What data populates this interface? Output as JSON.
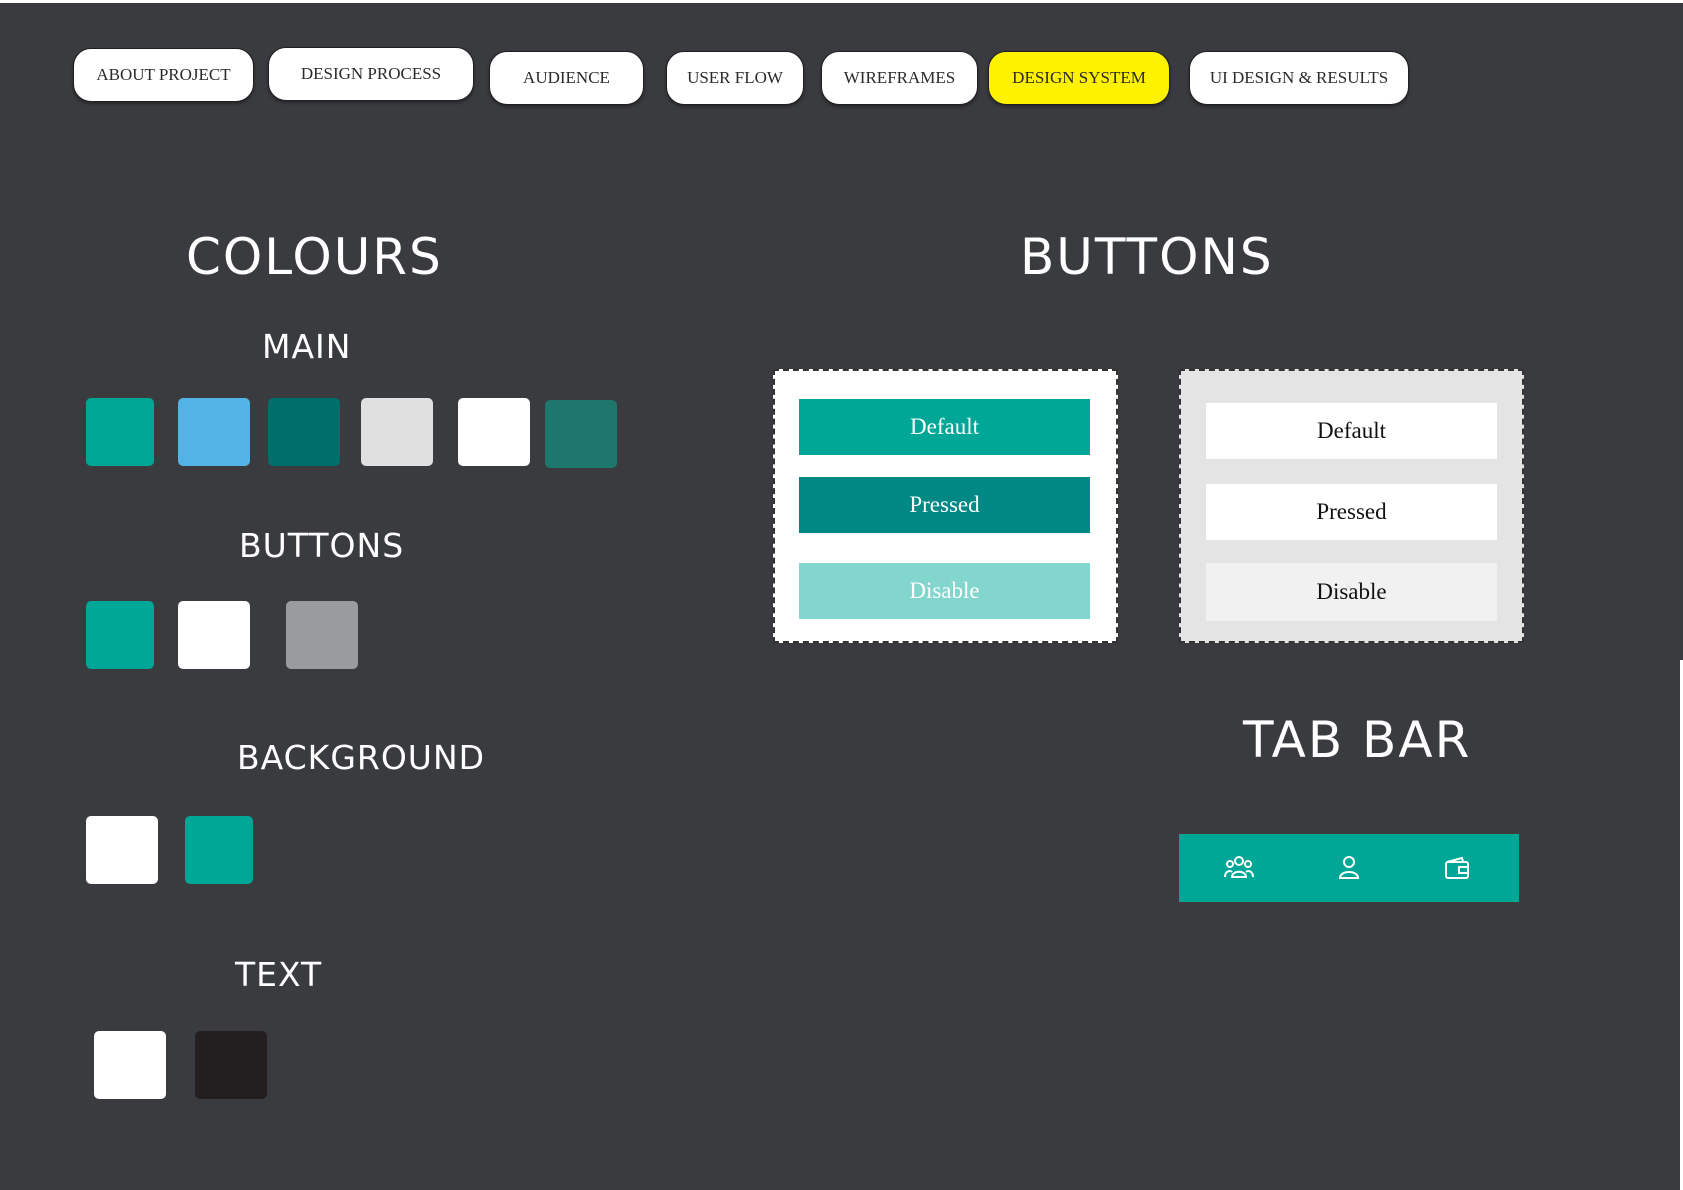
{
  "nav": {
    "items": [
      {
        "label": "ABOUT PROJECT"
      },
      {
        "label": "DESIGN PROCESS"
      },
      {
        "label": "AUDIENCE"
      },
      {
        "label": "USER FLOW"
      },
      {
        "label": "WIREFRAMES"
      },
      {
        "label": "DESIGN SYSTEM",
        "active": true
      },
      {
        "label": "UI DESIGN & RESULTS"
      }
    ]
  },
  "colours": {
    "title": "COLOURS",
    "main": {
      "label": "MAIN",
      "swatches": [
        "#00a696",
        "#52b4e6",
        "#006e69",
        "#dfe0df",
        "#ffffff",
        "#1e776d"
      ]
    },
    "buttons": {
      "label": "BUTTONS",
      "swatches": [
        "#00a696",
        "#ffffff",
        "#9a9b9e"
      ]
    },
    "background": {
      "label": "BACKGROUND",
      "swatches": [
        "#ffffff",
        "#00a696"
      ]
    },
    "text": {
      "label": "TEXT",
      "swatches": [
        "#ffffff",
        "#231f20"
      ]
    }
  },
  "buttons_section": {
    "title": "BUTTONS",
    "primary": {
      "default_label": "Default",
      "pressed_label": "Pressed",
      "disable_label": "Disable",
      "colors": {
        "default": "#00a696",
        "pressed": "#008885",
        "disable": "#83d6cd"
      }
    },
    "secondary": {
      "default_label": "Default",
      "pressed_label": "Pressed",
      "disable_label": "Disable",
      "colors": {
        "panel": "#e4e4e4",
        "default": "#ffffff",
        "pressed": "#ffffff",
        "disable": "#f1f1f1"
      }
    }
  },
  "tab_bar": {
    "title": "TAB BAR",
    "color": "#00a696",
    "icons": [
      "group-icon",
      "user-icon",
      "wallet-icon"
    ]
  }
}
